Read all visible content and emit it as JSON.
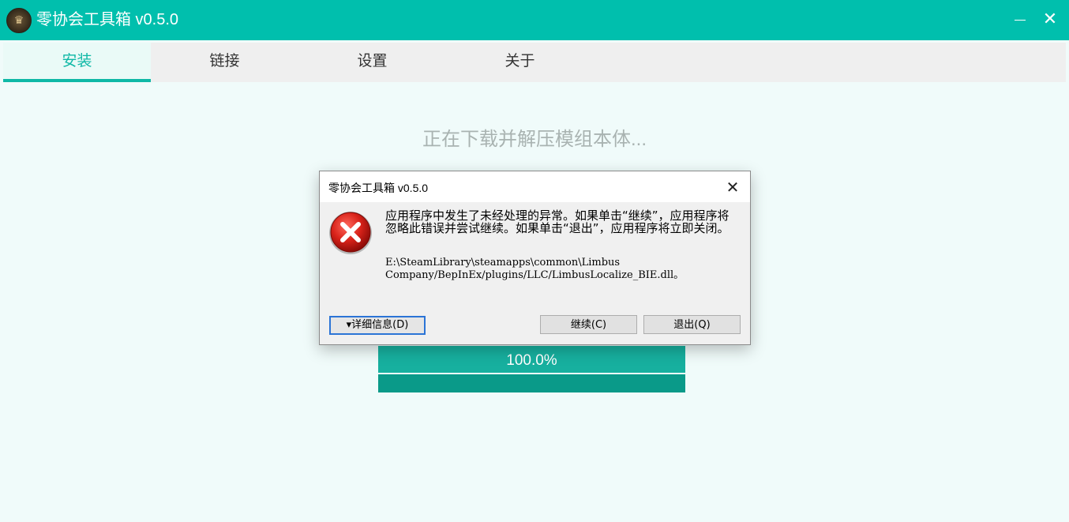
{
  "app": {
    "title": "零协会工具箱 v0.5.0"
  },
  "window_controls": {
    "minimize": "—",
    "close": "✕"
  },
  "tabs": [
    {
      "label": "安装",
      "active": true
    },
    {
      "label": "链接",
      "active": false
    },
    {
      "label": "设置",
      "active": false
    },
    {
      "label": "关于",
      "active": false
    }
  ],
  "install": {
    "status_text": "正在下载并解压模组本体...",
    "progress_label": "100.0%",
    "progress_value": 1.0
  },
  "dialog": {
    "title": "零协会工具箱 v0.5.0",
    "close": "✕",
    "icon": "error-icon",
    "message": "应用程序中发生了未经处理的异常。如果单击“继续”，应用程序将忽略此错误并尝试继续。如果单击“退出”，应用程序将立即关闭。",
    "path_line1": "E:\\SteamLibrary\\steamapps\\common\\Limbus",
    "path_line2": "Company/BepInEx/plugins/LLC/LimbusLocalize_BIE.dll。",
    "details_button": "▾详细信息(D)",
    "continue_button": "继续(C)",
    "quit_button": "退出(Q)"
  },
  "colors": {
    "accent": "#00bfad",
    "tab_active": "#0fb8a6",
    "progress": "#17b09f",
    "background": "#f0fbfa"
  }
}
